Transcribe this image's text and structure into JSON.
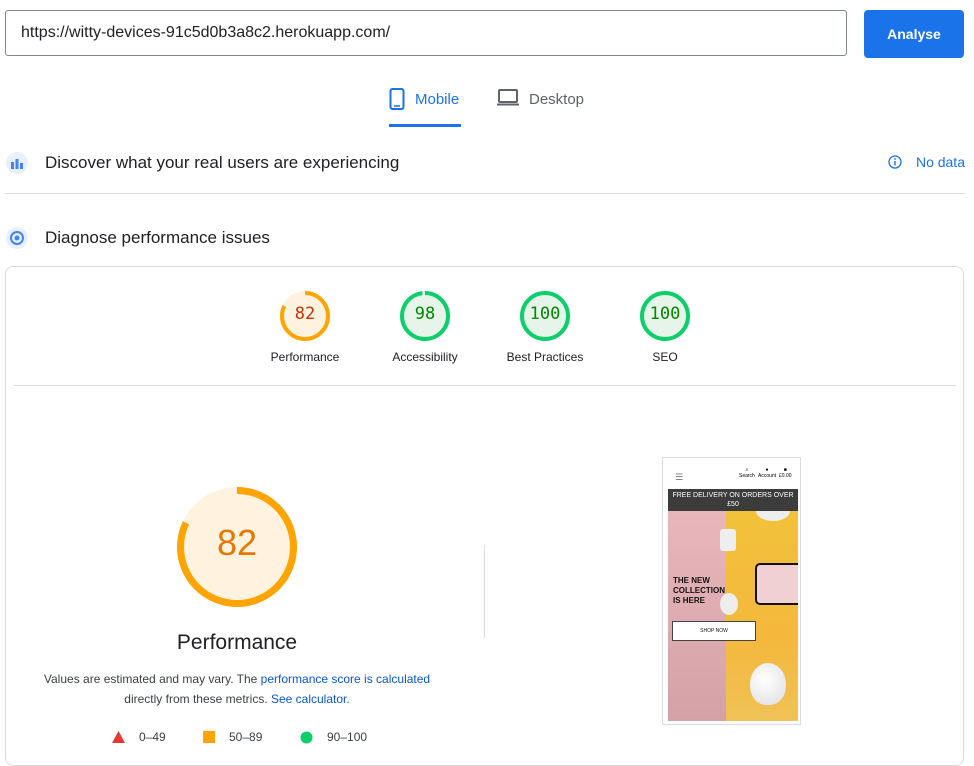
{
  "url_bar": {
    "value": "https://witty-devices-91c5d0b3a8c2.herokuapp.com/"
  },
  "analyse_button": {
    "label": "Analyse"
  },
  "tabs": [
    {
      "label": "Mobile",
      "icon": "smartphone-icon",
      "active": true
    },
    {
      "label": "Desktop",
      "icon": "laptop-icon",
      "active": false
    }
  ],
  "real_users": {
    "title": "Discover what your real users are experiencing",
    "status": "No data",
    "icon": "crux-icon"
  },
  "diagnose": {
    "title": "Diagnose performance issues",
    "icon": "lighthouse-icon"
  },
  "scores": [
    {
      "label": "Performance",
      "value": "82",
      "fraction": 0.82,
      "color": "#ffa400",
      "text_color": "#c33300",
      "fill": "#fff3e0"
    },
    {
      "label": "Accessibility",
      "value": "98",
      "fraction": 0.98,
      "color": "#0cce6b",
      "text_color": "#008800",
      "fill": "#e6f4ea"
    },
    {
      "label": "Best Practices",
      "value": "100",
      "fraction": 1.0,
      "color": "#0cce6b",
      "text_color": "#008800",
      "fill": "#e6f4ea"
    },
    {
      "label": "SEO",
      "value": "100",
      "fraction": 1.0,
      "color": "#0cce6b",
      "text_color": "#008800",
      "fill": "#e6f4ea"
    }
  ],
  "performance": {
    "score": "82",
    "fraction": 0.82,
    "title": "Performance",
    "desc_1": "Values are estimated and may vary. The ",
    "desc_link_1": "performance score is calculated",
    "desc_2": "directly from these metrics. ",
    "desc_link_2": "See calculator."
  },
  "legend": [
    {
      "range": "0–49",
      "shape": "triangle",
      "color": "#e53935"
    },
    {
      "range": "50–89",
      "shape": "square",
      "color": "#ffa400"
    },
    {
      "range": "90–100",
      "shape": "circle",
      "color": "#0cce6b"
    }
  ],
  "screenshot": {
    "header_items": [
      "Search",
      "Account",
      "£0.00"
    ],
    "banner": "FREE DELIVERY ON ORDERS OVER £50",
    "hero_text": [
      "THE NEW",
      "COLLECTION",
      "IS HERE"
    ],
    "shop_button": "SHOP NOW"
  }
}
